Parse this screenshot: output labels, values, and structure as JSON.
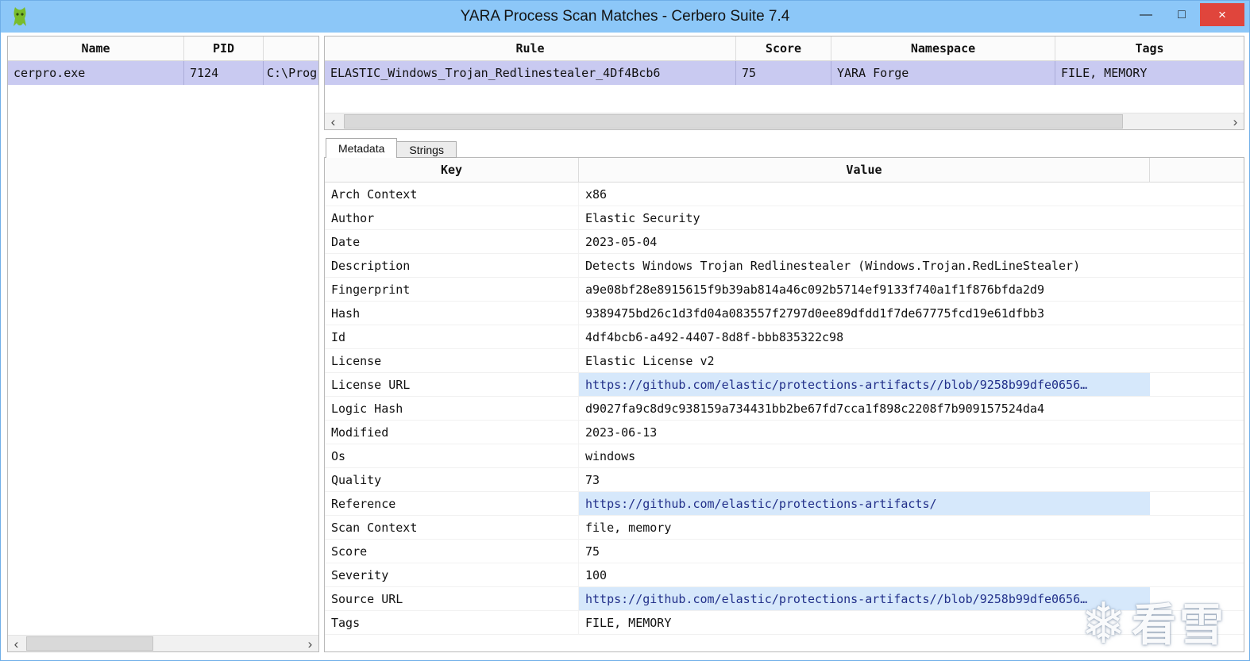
{
  "window": {
    "title": "YARA Process Scan Matches - Cerbero Suite 7.4",
    "controls": {
      "minimize": "—",
      "maximize": "□",
      "close": "×"
    }
  },
  "icons": {
    "scroll_left": "‹",
    "scroll_right": "›"
  },
  "process_table": {
    "columns": {
      "name": "Name",
      "pid": "PID",
      "path": ""
    },
    "row": {
      "name": "cerpro.exe",
      "pid": "7124",
      "path": "C:\\Prog"
    }
  },
  "matches_table": {
    "columns": {
      "rule": "Rule",
      "score": "Score",
      "namespace": "Namespace",
      "tags": "Tags"
    },
    "row": {
      "rule": "ELASTIC_Windows_Trojan_Redlinestealer_4Df4Bcb6",
      "score": "75",
      "namespace": "YARA Forge",
      "tags": "FILE, MEMORY"
    }
  },
  "tabs": {
    "metadata": "Metadata",
    "strings": "Strings"
  },
  "metadata_table": {
    "columns": {
      "key": "Key",
      "value": "Value"
    },
    "rows": [
      {
        "key": "Arch Context",
        "value": "x86",
        "highlight": false
      },
      {
        "key": "Author",
        "value": "Elastic Security",
        "highlight": false
      },
      {
        "key": "Date",
        "value": "2023-05-04",
        "highlight": false
      },
      {
        "key": "Description",
        "value": "Detects Windows Trojan Redlinestealer (Windows.Trojan.RedLineStealer)",
        "highlight": false
      },
      {
        "key": "Fingerprint",
        "value": "a9e08bf28e8915615f9b39ab814a46c092b5714ef9133f740a1f1f876bfda2d9",
        "highlight": false
      },
      {
        "key": "Hash",
        "value": "9389475bd26c1d3fd04a083557f2797d0ee89dfdd1f7de67775fcd19e61dfbb3",
        "highlight": false
      },
      {
        "key": "Id",
        "value": "4df4bcb6-a492-4407-8d8f-bbb835322c98",
        "highlight": false
      },
      {
        "key": "License",
        "value": "Elastic License v2",
        "highlight": false
      },
      {
        "key": "License URL",
        "value": "https://github.com/elastic/protections-artifacts//blob/9258b99dfe0656…",
        "highlight": true
      },
      {
        "key": "Logic Hash",
        "value": "d9027fa9c8d9c938159a734431bb2be67fd7cca1f898c2208f7b909157524da4",
        "highlight": false
      },
      {
        "key": "Modified",
        "value": "2023-06-13",
        "highlight": false
      },
      {
        "key": "Os",
        "value": "windows",
        "highlight": false
      },
      {
        "key": "Quality",
        "value": "73",
        "highlight": false
      },
      {
        "key": "Reference",
        "value": "https://github.com/elastic/protections-artifacts/",
        "highlight": true
      },
      {
        "key": "Scan Context",
        "value": "file, memory",
        "highlight": false
      },
      {
        "key": "Score",
        "value": "75",
        "highlight": false
      },
      {
        "key": "Severity",
        "value": "100",
        "highlight": false
      },
      {
        "key": "Source URL",
        "value": "https://github.com/elastic/protections-artifacts//blob/9258b99dfe0656…",
        "highlight": true
      },
      {
        "key": "Tags",
        "value": "FILE, MEMORY",
        "highlight": false
      }
    ]
  },
  "watermark": {
    "snowflake": "❄",
    "text": "看雪"
  },
  "colors": {
    "titlebar": "#8CC7F8",
    "selection": "#C9CAF1",
    "link_highlight": "#D6E8FB",
    "close_button": "#E0453C"
  }
}
